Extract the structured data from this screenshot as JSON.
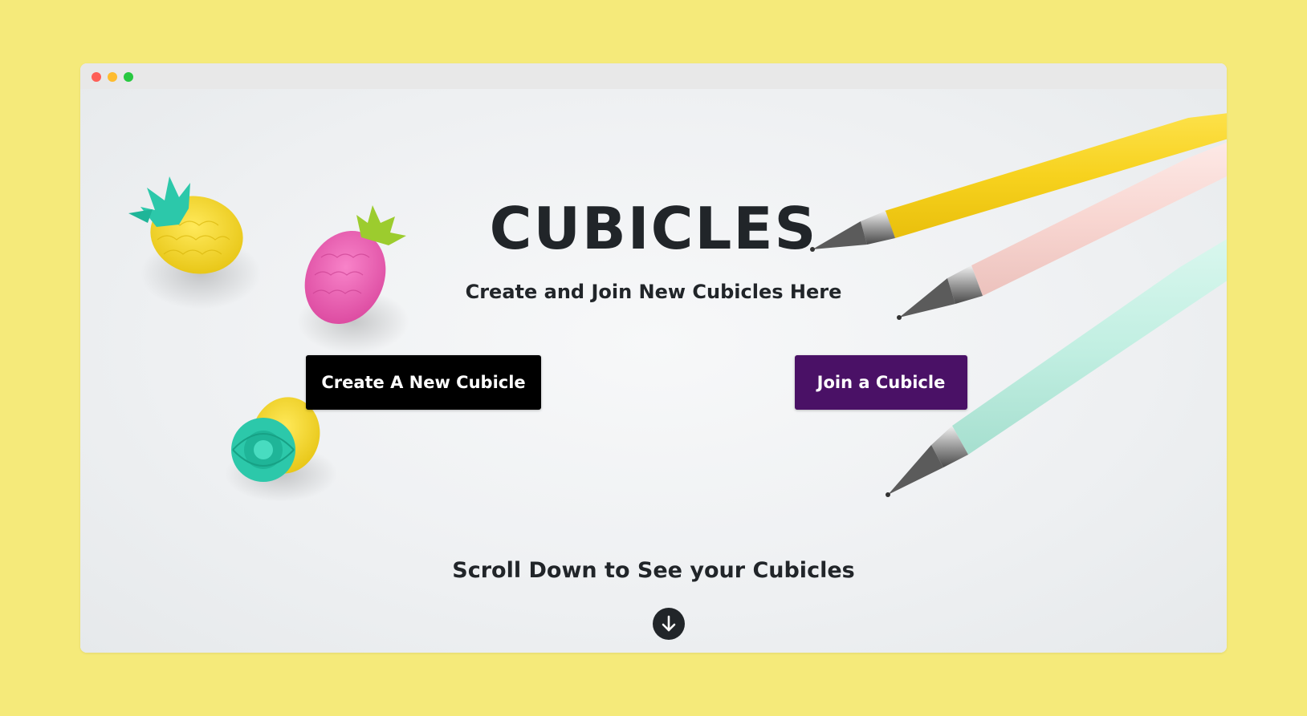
{
  "hero": {
    "title": "CUBICLES",
    "subtitle": "Create and Join New Cubicles Here",
    "create_button_label": "Create A New Cubicle",
    "join_button_label": "Join a Cubicle",
    "scroll_text": "Scroll Down to See your Cubicles"
  },
  "icons": {
    "scroll": "arrow-down-circle-icon"
  },
  "colors": {
    "page_background": "#f5ea7a",
    "create_button": "#000000",
    "join_button": "#4a1166",
    "text": "#212529"
  }
}
